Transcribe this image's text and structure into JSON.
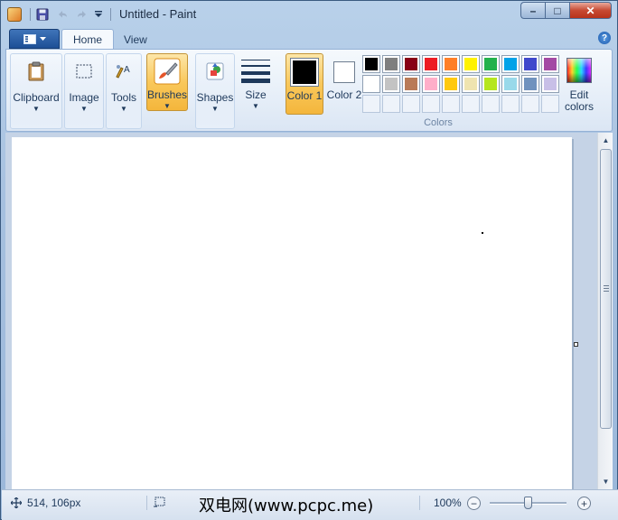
{
  "window": {
    "title": "Untitled - Paint",
    "controls": {
      "minimize": "–",
      "maximize": "□",
      "close": "✕"
    }
  },
  "quick_access": {
    "items": [
      "app-icon",
      "save-icon",
      "undo-icon",
      "redo-icon",
      "customize-dropdown-icon"
    ]
  },
  "ribbon": {
    "tabs": [
      {
        "label": "Home",
        "active": true
      },
      {
        "label": "View",
        "active": false
      }
    ],
    "groups": {
      "clipboard": "Clipboard",
      "image": "Image",
      "tools": "Tools",
      "brushes": "Brushes",
      "shapes": "Shapes",
      "size": "Size",
      "color1": "Color 1",
      "color2": "Color 2",
      "colors_caption": "Colors",
      "edit_colors": "Edit colors"
    },
    "color1_value": "#000000",
    "color2_value": "#ffffff",
    "palette": [
      "#000000",
      "#7f7f7f",
      "#880015",
      "#ed1c24",
      "#ff7f27",
      "#fff200",
      "#22b14c",
      "#00a2e8",
      "#3f48cc",
      "#a349a4",
      "#ffffff",
      "#c3c3c3",
      "#b97a57",
      "#ffaec9",
      "#ffc90e",
      "#efe4b0",
      "#b5e61d",
      "#99d9ea",
      "#7092be",
      "#c8bfe7",
      "",
      "",
      "",
      "",
      "",
      "",
      "",
      "",
      "",
      ""
    ]
  },
  "statusbar": {
    "cursor_position": "514, 106px",
    "zoom": "100%",
    "zoom_level": 1.0,
    "watermark": "双电网(www.pcpc.me)"
  },
  "colors": {
    "accent": "#f9c85b",
    "frame": "#b9d1ea"
  }
}
